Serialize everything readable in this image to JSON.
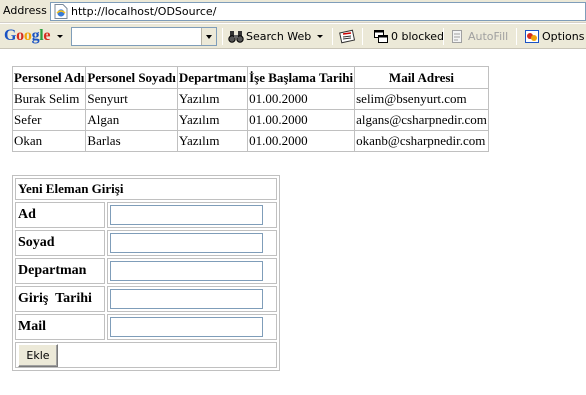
{
  "browser": {
    "address_label": "Address",
    "url": "http://localhost/ODSource/"
  },
  "toolbar": {
    "google_logo": [
      "G",
      "o",
      "o",
      "g",
      "l",
      "e"
    ],
    "google_logo_colors": [
      "#1a53c4",
      "#d62d20",
      "#f1a30a",
      "#1a53c4",
      "#2c9e3f",
      "#d62d20"
    ],
    "search_value": "",
    "search_web_label": "Search Web",
    "blocked_label": "0 blocked",
    "autofill_label": "AutoFill",
    "options_label": "Options"
  },
  "grid": {
    "headers": [
      "Personel Adı",
      "Personel Soyadı",
      "Departmanı",
      "İşe Başlama Tarihi",
      "Mail Adresi"
    ],
    "rows": [
      [
        "Burak Selim",
        "Senyurt",
        "Yazılım",
        "01.00.2000",
        "selim@bsenyurt.com"
      ],
      [
        "Sefer",
        "Algan",
        "Yazılım",
        "01.00.2000",
        "algans@csharpnedir.com"
      ],
      [
        "Okan",
        "Barlas",
        "Yazılım",
        "01.00.2000",
        "okanb@csharpnedir.com"
      ]
    ]
  },
  "form": {
    "title": "Yeni Eleman Girişi",
    "fields": [
      {
        "label": "Ad",
        "value": ""
      },
      {
        "label": "Soyad",
        "value": ""
      },
      {
        "label": "Departman",
        "value": ""
      },
      {
        "label": "Giriş  Tarihi",
        "value": ""
      },
      {
        "label": "Mail",
        "value": ""
      }
    ],
    "submit_label": "Ekle"
  }
}
